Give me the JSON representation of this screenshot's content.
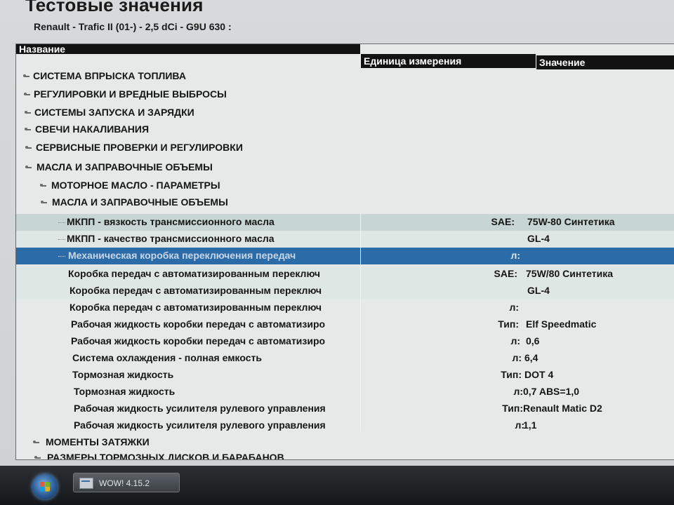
{
  "page": {
    "title": "Тестовые значения",
    "vehicle": "Renault - Trafic II (01-) - 2,5 dCi - G9U 630 :"
  },
  "columns": {
    "name": "Название",
    "unit": "Единица измерения",
    "value": "Значение"
  },
  "tree": [
    {
      "label": "СИСТЕМА ВПРЫСКА ТОПЛИВА"
    },
    {
      "label": "РЕГУЛИРОВКИ И ВРЕДНЫЕ ВЫБРОСЫ"
    },
    {
      "label": "СИСТЕМЫ ЗАПУСКА И ЗАРЯДКИ"
    },
    {
      "label": "СВЕЧИ НАКАЛИВАНИЯ"
    },
    {
      "label": "СЕРВИСНЫЕ ПРОВЕРКИ И РЕГУЛИРОВКИ"
    },
    {
      "label": "МАСЛА И ЗАПРАВОЧНЫЕ ОБЪЕМЫ"
    },
    {
      "label": "МОТОРНОЕ МАСЛО - ПАРАМЕТРЫ"
    },
    {
      "label": "МАСЛА И ЗАПРАВОЧНЫЕ ОБЪЕМЫ"
    }
  ],
  "items": [
    {
      "name": "МКПП - вязкость трансмиссионного масла",
      "unit": "SAE:",
      "value": "75W-80  Синтетика"
    },
    {
      "name": "МКПП - качество трансмиссионного масла",
      "unit": "",
      "value": "GL-4"
    },
    {
      "name": "Механическая коробка переключения передач",
      "unit": "л:",
      "value": ""
    },
    {
      "name": "Коробка передач с автоматизированным переключ",
      "unit": "SAE:",
      "value": "75W/80  Синтетика"
    },
    {
      "name": "Коробка передач с автоматизированным переключ",
      "unit": "",
      "value": "GL-4"
    },
    {
      "name": "Коробка передач с автоматизированным переключ",
      "unit": "л:",
      "value": ""
    },
    {
      "name": "Рабочая жидкость коробки передач с автоматизиро",
      "unit": "Тип:",
      "value": "Elf Speedmatic"
    },
    {
      "name": "Рабочая жидкость коробки передач с автоматизиро",
      "unit": "л:",
      "value": "0,6"
    },
    {
      "name": "Система охлаждения  - полная емкость",
      "unit": "л:",
      "value": "6,4"
    },
    {
      "name": "Тормозная жидкость",
      "unit": "Тип:",
      "value": "DOT 4"
    },
    {
      "name": "Тормозная жидкость",
      "unit": "л:",
      "value": "0,7 ABS=1,0"
    },
    {
      "name": "Рабочая жидкость усилителя рулевого управления",
      "unit": "Тип:",
      "value": "Renault Matic D2"
    },
    {
      "name": "Рабочая жидкость усилителя рулевого управления",
      "unit": "л:",
      "value": "1,1"
    }
  ],
  "tree_bottom": [
    {
      "label": "МОМЕНТЫ ЗАТЯЖКИ"
    },
    {
      "label": "РАЗМЕРЫ ТОРМОЗНЫХ ДИСКОВ И БАРАБАНОВ"
    }
  ],
  "taskbar": {
    "task_label": "WOW! 4.15.2"
  },
  "colors": {
    "selected_row": "#2b6ca8",
    "shaded_row": "#c7d6d2",
    "header_bg": "#121212"
  }
}
